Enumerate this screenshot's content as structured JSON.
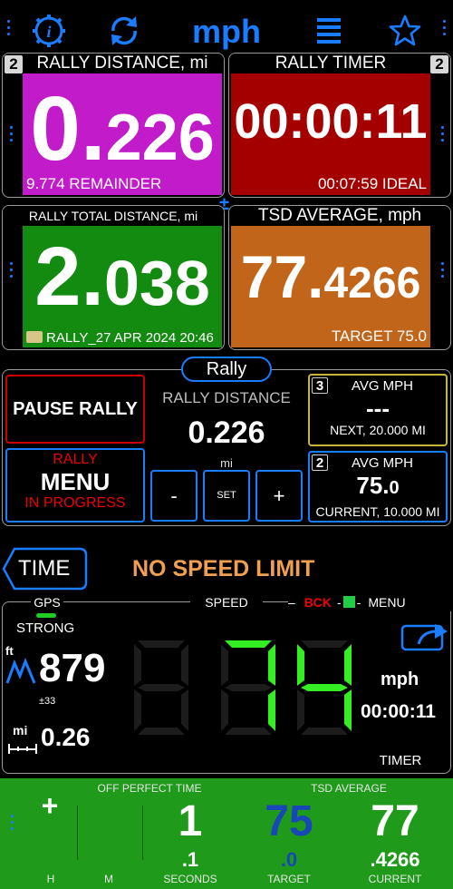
{
  "header": {
    "unit_title": "mph",
    "icons": [
      "info-icon",
      "refresh-icon",
      "list-icon",
      "star-icon"
    ]
  },
  "tiles": {
    "rally_distance": {
      "badge": "2",
      "title": "RALLY DISTANCE, mi",
      "value_int": "0.",
      "value_dec": "226",
      "footer": "9.774 REMAINDER",
      "color": "#c21bc9"
    },
    "rally_timer": {
      "badge": "2",
      "title": "RALLY TIMER",
      "value": "00:00:11",
      "footer": "00:07:59 IDEAL",
      "color": "#a40000"
    },
    "plus_minus": "±",
    "rally_total": {
      "title": "RALLY TOTAL DISTANCE, mi",
      "value_int": "2.",
      "value_dec": "038",
      "footer": "RALLY_27 APR 2024 20:46",
      "color": "#138a10"
    },
    "tsd_average": {
      "title": "TSD AVERAGE, mph",
      "value_int": "77.",
      "value_dec": "4266",
      "footer": "TARGET 75.0",
      "color": "#c1651a"
    }
  },
  "controls": {
    "rally_pill": "Rally",
    "pause_label": "PAUSE RALLY",
    "menu_top": "RALLY",
    "menu_label": "MENU",
    "menu_bottom": "IN PROGRESS",
    "rally_distance_label": "RALLY DISTANCE",
    "rally_distance_value": "0.226",
    "rally_distance_unit": "mi",
    "minus_label": "-",
    "set_label": "SET",
    "plus_label": "+",
    "avg_next": {
      "badge": "3",
      "title": "AVG  MPH",
      "value": "---",
      "footer": "NEXT, 20.000 MI"
    },
    "avg_current": {
      "badge": "2",
      "title": "AVG  MPH",
      "value_int": "75.",
      "value_dec": "0",
      "footer": "CURRENT, 10.000 MI"
    }
  },
  "speed": {
    "time_tab": "TIME",
    "limit_text": "NO SPEED LIMIT",
    "gps_label": "GPS",
    "gps_strength": "STRONG",
    "speed_label": "SPEED",
    "bck_label": "BCK",
    "menu_label": "MENU",
    "altitude_unit": "ft",
    "altitude_value": "879",
    "altitude_accuracy": "±33",
    "dist_unit": "mi",
    "dist_value": "0.26",
    "speed_value": "74",
    "speed_unit": "mph",
    "elapsed": "00:00:11",
    "timer_label": "TIMER"
  },
  "bottom": {
    "off_perfect_label": "OFF PERFECT TIME",
    "tsd_label": "TSD AVERAGE",
    "sign": "+",
    "h_label": "H",
    "m_label": "M",
    "seconds_int": "1",
    "seconds_dec": ".1",
    "seconds_label": "SECONDS",
    "target_int": "75",
    "target_dec": ".0",
    "target_label": "TARGET",
    "current_int": "77",
    "current_dec": ".4266",
    "current_label": "CURRENT",
    "bg_color": "#1f9a1a"
  }
}
